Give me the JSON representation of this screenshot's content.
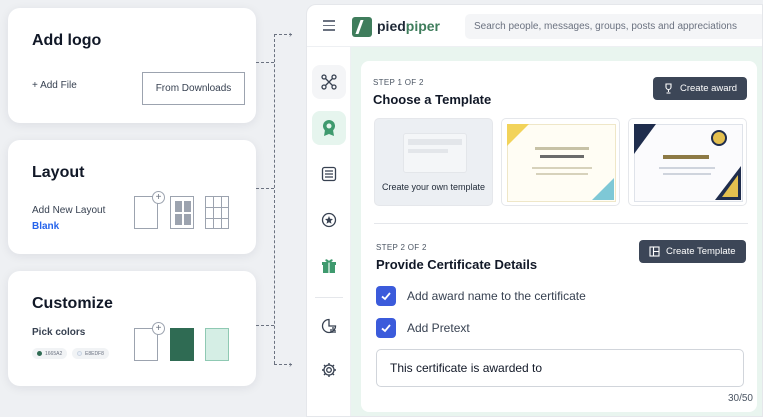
{
  "cards": {
    "logo": {
      "title": "Add logo",
      "add_file": "+ Add File",
      "from_downloads": "From Downloads"
    },
    "layout": {
      "title": "Layout",
      "add_new_layout": "Add New Layout",
      "blank": "Blank"
    },
    "customize": {
      "title": "Customize",
      "pick_colors": "Pick colors",
      "color1": "1665A2",
      "color2": "E8EDF8"
    }
  },
  "app": {
    "brand_a": "pied",
    "brand_b": "piper",
    "search_placeholder": "Search people, messages, groups, posts and appreciations",
    "step1": "STEP 1 OF 2",
    "choose_template": "Choose a Template",
    "create_award": "Create award",
    "create_own": "Create your own template",
    "step2": "STEP 2 OF 2",
    "provide_details": "Provide Certificate Details",
    "create_template": "Create Template",
    "check1": "Add award name to the certificate",
    "check2": "Add Pretext",
    "pretext_value": "This certificate is awarded to",
    "counter": "30/50"
  },
  "colors": {
    "accent_green": "#3f7d5c",
    "checkbox_blue": "#3b5bdb",
    "button_dark": "#3c4657",
    "swatch_dark_green": "#2f6b53",
    "swatch_mint": "#d5eee5"
  }
}
